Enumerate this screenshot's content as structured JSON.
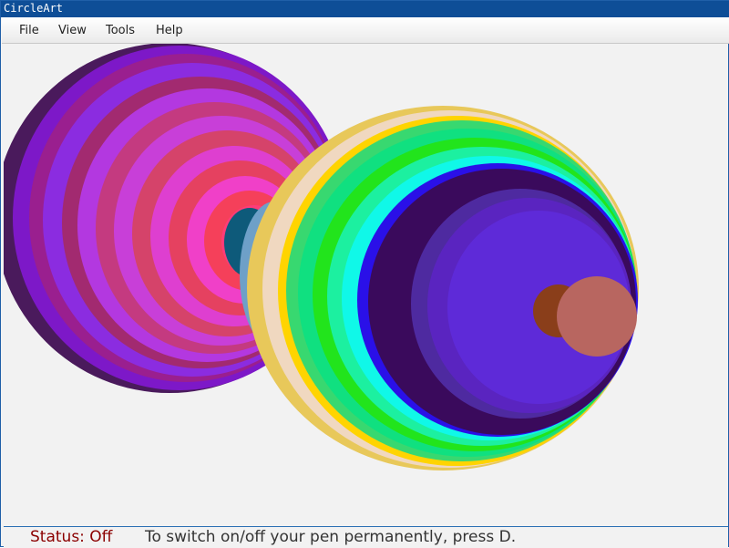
{
  "window": {
    "title": "CircleArt"
  },
  "menu": {
    "items": [
      "File",
      "View",
      "Tools",
      "Help"
    ]
  },
  "status": {
    "label": "Status: Off",
    "hint": "To switch on/off your pen permanently, press D."
  },
  "colors": {
    "accent": "#0e4e97",
    "status_off": "#8b0000",
    "canvas_background": "#f2f2f2"
  }
}
